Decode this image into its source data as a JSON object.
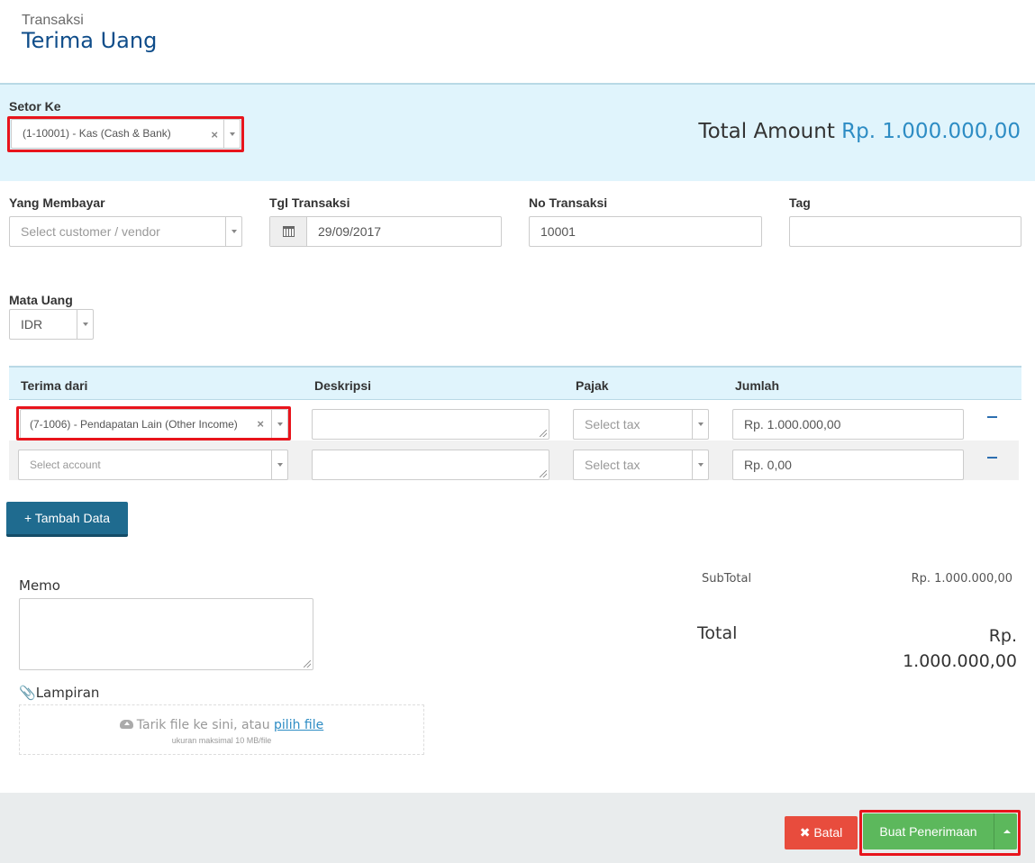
{
  "header": {
    "breadcrumb": "Transaksi",
    "title": "Terima Uang"
  },
  "deposit": {
    "label": "Setor Ke",
    "value": "(1-10001) - Kas (Cash & Bank)",
    "total_label": "Total Amount",
    "total_value": "Rp. 1.000.000,00"
  },
  "fields": {
    "payer": {
      "label": "Yang Membayar",
      "placeholder": "Select customer / vendor"
    },
    "date": {
      "label": "Tgl Transaksi",
      "value": "29/09/2017"
    },
    "number": {
      "label": "No Transaksi",
      "value": "10001"
    },
    "tag": {
      "label": "Tag",
      "value": ""
    },
    "currency": {
      "label": "Mata Uang",
      "value": "IDR"
    }
  },
  "table": {
    "headers": [
      "Terima dari",
      "Deskripsi",
      "Pajak",
      "Jumlah"
    ],
    "rows": [
      {
        "account": "(7-1006) - Pendapatan Lain (Other Income)",
        "description": "",
        "tax_placeholder": "Select tax",
        "amount": "Rp. 1.000.000,00"
      },
      {
        "account_placeholder": "Select account",
        "description": "",
        "tax_placeholder": "Select tax",
        "amount": "Rp. 0,00"
      }
    ],
    "add_label": "+ Tambah Data"
  },
  "memo": {
    "label": "Memo",
    "value": ""
  },
  "attachment": {
    "label": "Lampiran",
    "drop_text": "Tarik file ke sini, atau ",
    "drop_link": "pilih file",
    "drop_hint": "ukuran maksimal 10 MB/file"
  },
  "summary": {
    "subtotal_label": "SubTotal",
    "subtotal_value": "Rp. 1.000.000,00",
    "total_label": "Total",
    "total_currency": "Rp.",
    "total_value": "1.000.000,00"
  },
  "actions": {
    "cancel_label": "Batal",
    "submit_label": "Buat Penerimaan"
  },
  "colors": {
    "accent": "#2d8cc4",
    "title": "#0f4d8a",
    "band": "#e0f4fc",
    "cancel": "#e84c3d",
    "submit": "#5cb85c",
    "highlight": "#e8141c"
  }
}
